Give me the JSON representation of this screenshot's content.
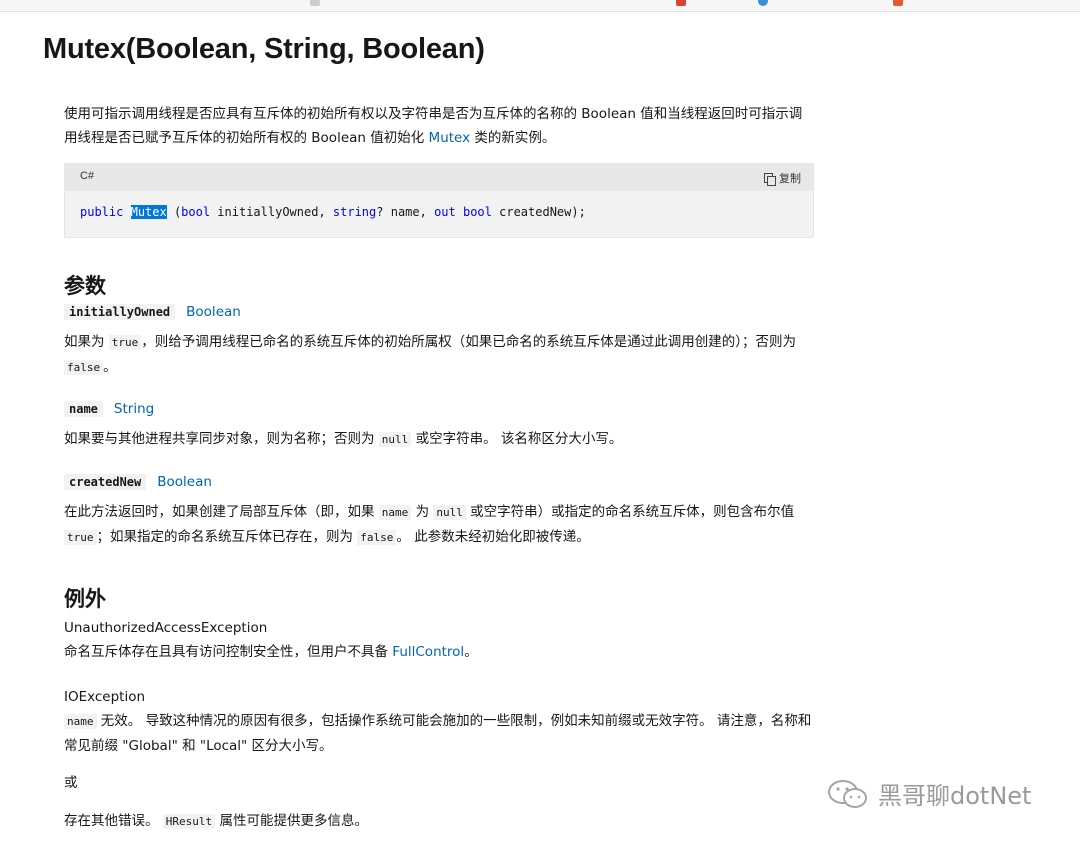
{
  "page": {
    "title": "Mutex(Boolean, String, Boolean)",
    "description_part1": "使用可指示调用线程是否应具有互斥体的初始所有权以及字符串是否为互斥体的名称的 Boolean 值和当线程返回时可指示调用线程是否已赋予互斥体的初始所有权的 Boolean 值初始化 ",
    "description_link": "Mutex",
    "description_part2": " 类的新实例。"
  },
  "code": {
    "language": "C#",
    "copy_label": "复制",
    "tokens": {
      "public": "public",
      "ctor": "Mutex",
      "rest1": " (",
      "bool1": "bool",
      "p1": " initiallyOwned, ",
      "string": "string",
      "p2": "? name, ",
      "out": "out",
      "space": " ",
      "bool2": "bool",
      "p3": " createdNew);"
    }
  },
  "params_section": {
    "heading": "参数",
    "items": [
      {
        "name": "initiallyOwned",
        "type": "Boolean",
        "text_a": "如果为 ",
        "code_a": "true",
        "text_b": "，则给予调用线程已命名的系统互斥体的初始所属权（如果已命名的系统互斥体是通过此调用创建的）；否则为 ",
        "code_b": "false",
        "text_c": "。"
      },
      {
        "name": "name",
        "type": "String",
        "text_a": "如果要与其他进程共享同步对象，则为名称；否则为 ",
        "code_a": "null",
        "text_b": " 或空字符串。 该名称区分大小写。"
      },
      {
        "name": "createdNew",
        "type": "Boolean",
        "text_a": "在此方法返回时，如果创建了局部互斥体（即，如果 ",
        "code_a": "name",
        "text_b": " 为 ",
        "code_b": "null",
        "text_c": " 或空字符串）或指定的命名系统互斥体，则包含布尔值 ",
        "code_c": "true",
        "text_d": "；如果指定的命名系统互斥体已存在，则为 ",
        "code_d": "false",
        "text_e": "。 此参数未经初始化即被传递。"
      }
    ]
  },
  "exceptions_section": {
    "heading": "例外",
    "items": [
      {
        "name": "UnauthorizedAccessException",
        "text_a": "命名互斥体存在且具有访问控制安全性，但用户不具备 ",
        "link": "FullControl",
        "text_b": "。"
      },
      {
        "name": "IOException",
        "code_a": "name",
        "text_a": " 无效。 导致这种情况的原因有很多，包括操作系统可能会施加的一些限制，例如未知前缀或无效字符。 请注意，名称和常见前缀 \"Global\" 和 \"Local\" 区分大小写。",
        "or": "或",
        "text_b": "存在其他错误。 ",
        "code_b": "HResult",
        "text_c": " 属性可能提供更多信息。"
      }
    ]
  },
  "watermark": {
    "text": "黑哥聊dotNet"
  },
  "colors": {
    "link": "#0065b3",
    "keyword": "#0000ff",
    "selection": "#0078d7"
  }
}
